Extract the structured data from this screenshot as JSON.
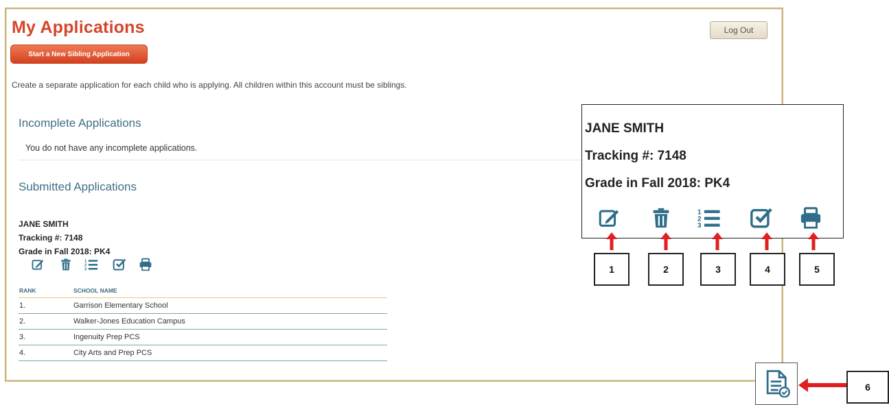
{
  "page": {
    "title": "My Applications",
    "logout_label": "Log Out",
    "start_button_label": "Start a New Sibling Application",
    "instruction": "Create a separate application for each child who is applying. All children within this account must be siblings."
  },
  "incomplete": {
    "heading": "Incomplete Applications",
    "empty_message": "You do not have any incomplete applications."
  },
  "submitted": {
    "heading": "Submitted Applications",
    "applicant": {
      "name": "JANE SMITH",
      "tracking": "Tracking #: 7148",
      "grade": "Grade in Fall 2018: PK4"
    },
    "action_icons": [
      "edit-icon",
      "trash-icon",
      "ranked-list-icon",
      "checkbox-icon",
      "print-icon"
    ],
    "table": {
      "headers": [
        "RANK",
        "SCHOOL NAME"
      ],
      "rows": [
        {
          "rank": "1.",
          "school": "Garrison Elementary School"
        },
        {
          "rank": "2.",
          "school": "Walker-Jones Education Campus"
        },
        {
          "rank": "3.",
          "school": "Ingenuity Prep PCS"
        },
        {
          "rank": "4.",
          "school": "City Arts and Prep PCS"
        }
      ]
    }
  },
  "callout": {
    "name": "JANE SMITH",
    "tracking": "Tracking #: 7148",
    "grade": "Grade in Fall 2018: PK4",
    "labels": [
      "1",
      "2",
      "3",
      "4",
      "5",
      "6"
    ],
    "extra_icon": "document-check-icon"
  },
  "colors": {
    "title": "#d6452a",
    "start_button": "#d4401f",
    "heading": "#3d6f85",
    "icon": "#2f6d8a",
    "arrow": "#e02020",
    "frame_border": "#c8b27a"
  }
}
